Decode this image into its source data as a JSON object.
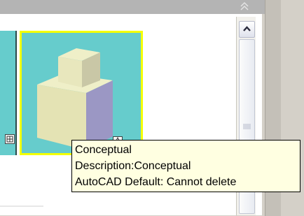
{
  "palette": {
    "items": [
      {
        "name": "Conceptual",
        "selected": true
      }
    ]
  },
  "tooltip": {
    "title": "Conceptual",
    "description": "Description:Conceptual",
    "note": "AutoCAD Default: Cannot delete"
  },
  "colors": {
    "tile_background": "#66cccc",
    "selection_border": "#f4ff00",
    "tooltip_background": "#ffffe1"
  }
}
